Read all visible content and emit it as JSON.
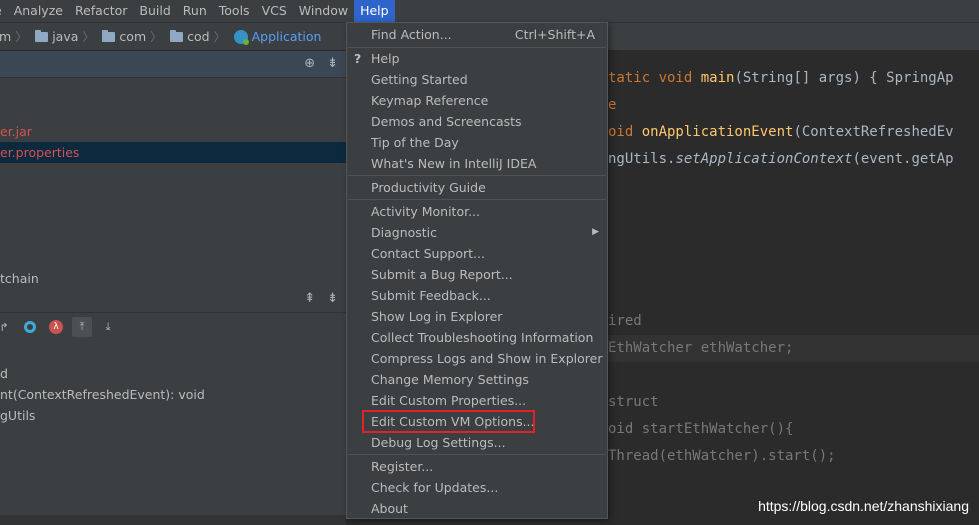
{
  "menubar": {
    "items": [
      "e",
      "Analyze",
      "Refactor",
      "Build",
      "Run",
      "Tools",
      "VCS",
      "Window",
      "Help"
    ]
  },
  "breadcrumb": {
    "items": [
      "m",
      "java",
      "com",
      "cod",
      "Application"
    ]
  },
  "project_tree": {
    "rows": [
      "er.jar",
      "er.properties",
      "tchain"
    ]
  },
  "structure": {
    "rows": [
      "d",
      "nt(ContextRefreshedEvent): void",
      "gUtils"
    ]
  },
  "help_menu": {
    "items": [
      {
        "label": "Find Action...",
        "shortcut": "Ctrl+Shift+A"
      },
      {
        "label": "Help"
      },
      {
        "label": "Getting Started"
      },
      {
        "label": "Keymap Reference"
      },
      {
        "label": "Demos and Screencasts"
      },
      {
        "label": "Tip of the Day"
      },
      {
        "label": "What's New in IntelliJ IDEA"
      },
      {
        "label": "Productivity Guide"
      },
      {
        "label": "Activity Monitor..."
      },
      {
        "label": "Diagnostic"
      },
      {
        "label": "Contact Support..."
      },
      {
        "label": "Submit a Bug Report..."
      },
      {
        "label": "Submit Feedback..."
      },
      {
        "label": "Show Log in Explorer"
      },
      {
        "label": "Collect Troubleshooting Information"
      },
      {
        "label": "Compress Logs and Show in Explorer"
      },
      {
        "label": "Change Memory Settings"
      },
      {
        "label": "Edit Custom Properties..."
      },
      {
        "label": "Edit Custom VM Options..."
      },
      {
        "label": "Debug Log Settings..."
      },
      {
        "label": "Register..."
      },
      {
        "label": "Check for Updates..."
      },
      {
        "label": "About"
      }
    ]
  },
  "editor": {
    "lines": [
      {
        "a": "tatic void ",
        "b": "main",
        "c": "(String[] args) { SpringAp"
      },
      {
        "a": "e"
      },
      {
        "a": "oid ",
        "b": "onApplicationEvent",
        "c": "(ContextRefreshedEv"
      },
      {
        "a": "ngUtils.",
        "b": "setApplicationContext",
        "c": "(event.getAp"
      },
      {
        "a": "ired"
      },
      {
        "a": "EthWatcher ethWatcher;"
      },
      {
        "a": "struct"
      },
      {
        "a": "oid ",
        "b": "startEthWatcher",
        "c": "(){"
      },
      {
        "a": "Thread(ethWatcher).start();"
      }
    ]
  },
  "watermark": "https://blog.csdn.net/zhanshixiang",
  "colors": {
    "menu_active": "#2f65ca",
    "highlight_box": "#e0232a",
    "link_crumb": "#589df6"
  }
}
